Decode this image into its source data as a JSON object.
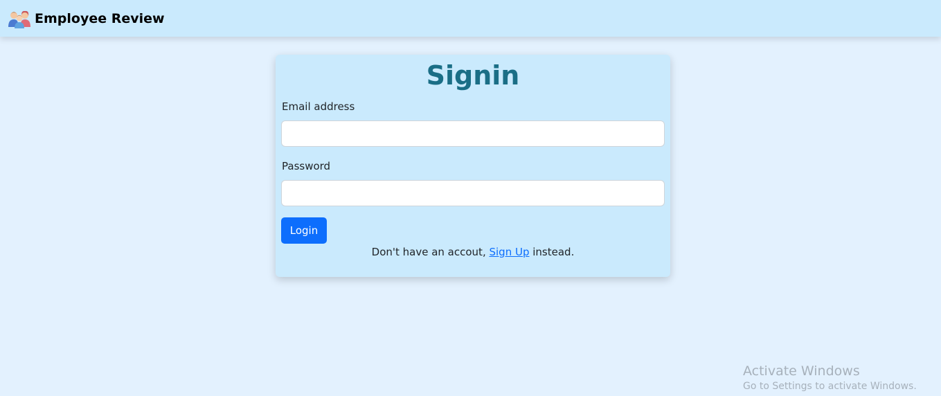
{
  "navbar": {
    "brand_text": "Employee Review",
    "logo_icon": "team-people-icon"
  },
  "signin": {
    "title": "Signin",
    "email_label": "Email address",
    "email_value": "",
    "password_label": "Password",
    "password_value": "",
    "login_button": "Login",
    "signup_prefix": "Don't have an accout, ",
    "signup_link": "Sign Up",
    "signup_suffix": " instead."
  },
  "watermark": {
    "title": "Activate Windows",
    "subtitle": "Go to Settings to activate Windows."
  },
  "colors": {
    "page_background": "#e3f1fe",
    "navbar_background": "#caeafd",
    "card_background": "#caeafd",
    "title_color": "#1a6e86",
    "primary_button": "#0d6efd"
  }
}
